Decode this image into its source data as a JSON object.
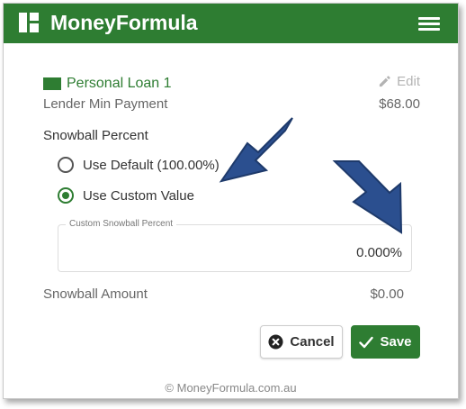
{
  "header": {
    "app_name": "MoneyFormula",
    "logo_icon": "grid-logo-icon",
    "menu_icon": "hamburger-menu-icon",
    "bg_color": "#2e7d32"
  },
  "loan": {
    "title": "Personal Loan 1",
    "color": "#2e7d32",
    "edit_label": "Edit",
    "min_payment_label": "Lender Min Payment",
    "min_payment_value": "$68.00"
  },
  "snowball": {
    "section_label": "Snowball Percent",
    "options": [
      {
        "label": "Use Default (100.00%)",
        "selected": false
      },
      {
        "label": "Use Custom Value",
        "selected": true
      }
    ],
    "custom_field_label": "Custom Snowball Percent",
    "custom_field_value": "0.000%",
    "amount_label": "Snowball Amount",
    "amount_value": "$0.00"
  },
  "actions": {
    "cancel_label": "Cancel",
    "save_label": "Save"
  },
  "footer": {
    "text": "© MoneyFormula.com.au"
  },
  "annotations": {
    "arrow_color": "#2b4f8f"
  }
}
